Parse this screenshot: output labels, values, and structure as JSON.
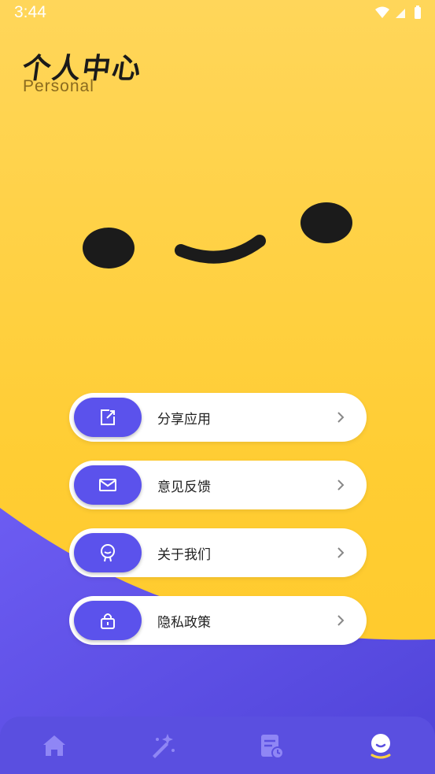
{
  "status_bar": {
    "time": "3:44"
  },
  "header": {
    "title": "个人中心",
    "subtitle": "Personal"
  },
  "menu": [
    {
      "label": "分享应用",
      "icon": "share-icon"
    },
    {
      "label": "意见反馈",
      "icon": "mail-icon"
    },
    {
      "label": "关于我们",
      "icon": "about-icon"
    },
    {
      "label": "隐私政策",
      "icon": "lock-icon"
    }
  ],
  "bottom_nav": [
    {
      "icon": "home-icon",
      "active": false
    },
    {
      "icon": "magic-wand-icon",
      "active": false
    },
    {
      "icon": "history-icon",
      "active": false
    },
    {
      "icon": "profile-smile-icon",
      "active": true
    }
  ],
  "colors": {
    "background": "#ffd040",
    "accent": "#5b52ec",
    "nav_active": "#ffd23f",
    "nav_inactive": "#8f86f5"
  }
}
